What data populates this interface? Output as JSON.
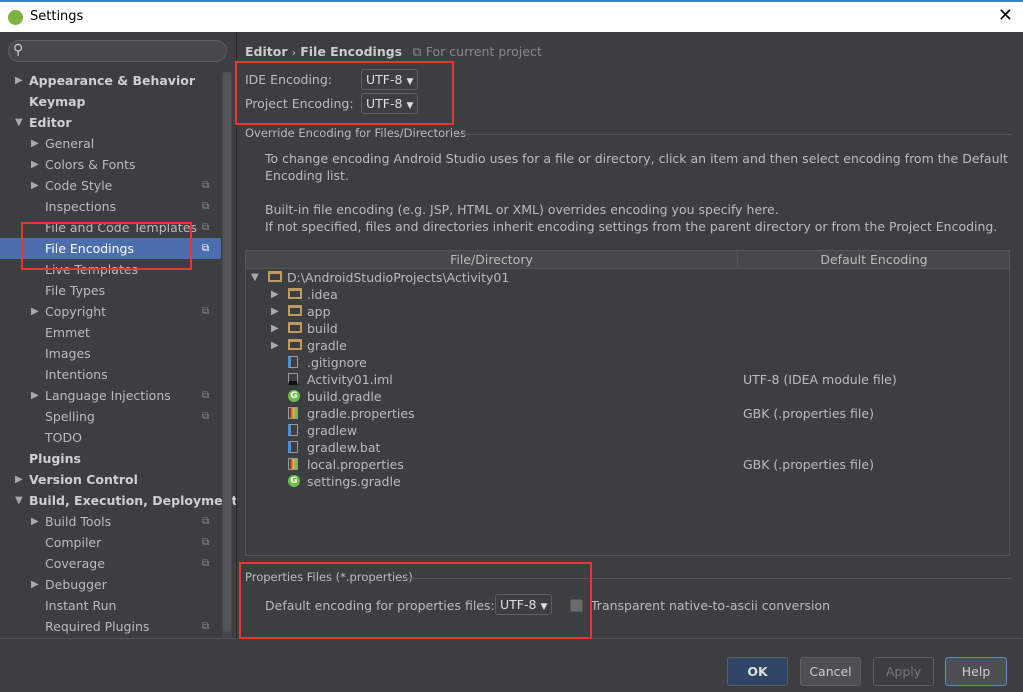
{
  "window": {
    "title": "Settings",
    "close_icon": "close-icon"
  },
  "sidebar": {
    "search_placeholder": "",
    "items": [
      {
        "label": "Appearance & Behavior",
        "level": 0,
        "arrow": "right",
        "bold": true
      },
      {
        "label": "Keymap",
        "level": 0,
        "arrow": "",
        "bold": true
      },
      {
        "label": "Editor",
        "level": 0,
        "arrow": "down",
        "bold": true
      },
      {
        "label": "General",
        "level": 1,
        "arrow": "right"
      },
      {
        "label": "Colors & Fonts",
        "level": 1,
        "arrow": "right"
      },
      {
        "label": "Code Style",
        "level": 1,
        "arrow": "right",
        "project": true
      },
      {
        "label": "Inspections",
        "level": 1,
        "arrow": "",
        "project": true
      },
      {
        "label": "File and Code Templates",
        "level": 1,
        "arrow": "",
        "project": true
      },
      {
        "label": "File Encodings",
        "level": 1,
        "arrow": "",
        "project": true,
        "selected": true
      },
      {
        "label": "Live Templates",
        "level": 1,
        "arrow": ""
      },
      {
        "label": "File Types",
        "level": 1,
        "arrow": ""
      },
      {
        "label": "Copyright",
        "level": 1,
        "arrow": "right",
        "project": true
      },
      {
        "label": "Emmet",
        "level": 1,
        "arrow": ""
      },
      {
        "label": "Images",
        "level": 1,
        "arrow": ""
      },
      {
        "label": "Intentions",
        "level": 1,
        "arrow": ""
      },
      {
        "label": "Language Injections",
        "level": 1,
        "arrow": "right",
        "project": true
      },
      {
        "label": "Spelling",
        "level": 1,
        "arrow": "",
        "project": true
      },
      {
        "label": "TODO",
        "level": 1,
        "arrow": ""
      },
      {
        "label": "Plugins",
        "level": 0,
        "arrow": "",
        "bold": true
      },
      {
        "label": "Version Control",
        "level": 0,
        "arrow": "right",
        "bold": true
      },
      {
        "label": "Build, Execution, Deployment",
        "level": 0,
        "arrow": "down",
        "bold": true
      },
      {
        "label": "Build Tools",
        "level": 1,
        "arrow": "right",
        "project": true
      },
      {
        "label": "Compiler",
        "level": 1,
        "arrow": "",
        "project": true
      },
      {
        "label": "Coverage",
        "level": 1,
        "arrow": "",
        "project": true
      },
      {
        "label": "Debugger",
        "level": 1,
        "arrow": "right"
      },
      {
        "label": "Instant Run",
        "level": 1,
        "arrow": ""
      },
      {
        "label": "Required Plugins",
        "level": 1,
        "arrow": "",
        "project": true
      }
    ]
  },
  "breadcrumb": {
    "parent": "Editor",
    "sep": "›",
    "current": "File Encodings",
    "scope": "For current project"
  },
  "ide_encoding": {
    "label": "IDE Encoding:",
    "value": "UTF-8"
  },
  "project_encoding": {
    "label": "Project Encoding:",
    "value": "UTF-8"
  },
  "override": {
    "title": "Override Encoding for Files/Directories",
    "desc1": "To change encoding Android Studio uses for a file or directory, click an item and then select encoding from the Default",
    "desc2": "Encoding list.",
    "desc3": "Built-in file encoding (e.g. JSP, HTML or XML) overrides encoding you specify here.",
    "desc4": "If not specified, files and directories inherit encoding settings from the parent directory or from the Project Encoding."
  },
  "table": {
    "columns": [
      "File/Directory",
      "Default Encoding"
    ],
    "rows": [
      {
        "name": "D:\\AndroidStudioProjects\\Activity01",
        "icon": "folder",
        "level": 0,
        "arrow": "down",
        "encoding": ""
      },
      {
        "name": ".idea",
        "icon": "folder",
        "level": 1,
        "arrow": "right",
        "encoding": ""
      },
      {
        "name": "app",
        "icon": "folder",
        "level": 1,
        "arrow": "right",
        "encoding": ""
      },
      {
        "name": "build",
        "icon": "folder",
        "level": 1,
        "arrow": "right",
        "encoding": ""
      },
      {
        "name": "gradle",
        "icon": "folder",
        "level": 1,
        "arrow": "right",
        "encoding": ""
      },
      {
        "name": ".gitignore",
        "icon": "text-file",
        "level": 1,
        "arrow": "",
        "encoding": ""
      },
      {
        "name": "Activity01.iml",
        "icon": "module-file",
        "level": 1,
        "arrow": "",
        "encoding": "UTF-8 (IDEA module file)"
      },
      {
        "name": "build.gradle",
        "icon": "gradle",
        "level": 1,
        "arrow": "",
        "encoding": ""
      },
      {
        "name": "gradle.properties",
        "icon": "properties-file",
        "level": 1,
        "arrow": "",
        "encoding": "GBK (.properties file)"
      },
      {
        "name": "gradlew",
        "icon": "text-file",
        "level": 1,
        "arrow": "",
        "encoding": ""
      },
      {
        "name": "gradlew.bat",
        "icon": "text-file",
        "level": 1,
        "arrow": "",
        "encoding": ""
      },
      {
        "name": "local.properties",
        "icon": "properties-file",
        "level": 1,
        "arrow": "",
        "encoding": "GBK (.properties file)"
      },
      {
        "name": "settings.gradle",
        "icon": "gradle",
        "level": 1,
        "arrow": "",
        "encoding": ""
      }
    ]
  },
  "properties": {
    "title": "Properties Files (*.properties)",
    "label": "Default encoding for properties files:",
    "value": "UTF-8",
    "checkbox_label": "Transparent native-to-ascii conversion",
    "checked": false
  },
  "buttons": {
    "ok": "OK",
    "cancel": "Cancel",
    "apply": "Apply",
    "help": "Help"
  },
  "colors": {
    "selection": "#4b6eaf",
    "background": "#3c3f41",
    "annotation": "#ee3333"
  }
}
